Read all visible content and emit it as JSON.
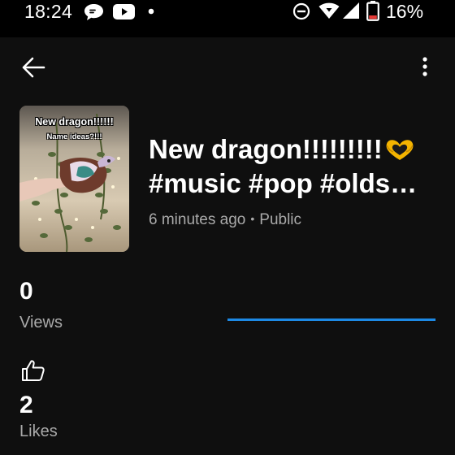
{
  "status_bar": {
    "time": "18:24",
    "battery_percent": "16%",
    "icons": [
      "chat-bubble-icon",
      "youtube-icon",
      "dot-icon",
      "do-not-disturb-icon",
      "wifi-icon",
      "signal-icon",
      "battery-icon"
    ]
  },
  "top_bar": {
    "back_icon": "arrow-left-icon",
    "more_icon": "more-vertical-icon"
  },
  "video": {
    "thumbnail_caption_1": "New dragon!!!!!!",
    "thumbnail_caption_2": "Name ideas?!!!",
    "title_line_1": "New dragon!!!!!!!!!",
    "title_line_2": "#music #pop #olds…",
    "posted": "6 minutes ago",
    "separator": "•",
    "visibility": "Public"
  },
  "stats": {
    "views_count": "0",
    "views_label": "Views",
    "likes_count": "2",
    "likes_label": "Likes",
    "likes_icon": "thumbs-up-icon"
  },
  "views_progress": {
    "fraction": 1.0,
    "color": "#1d89e4"
  },
  "colors": {
    "background": "#0f0f0f",
    "status_background": "#000000",
    "secondary_text": "#aaaaaa",
    "accent_blue": "#1d89e4",
    "battery_red": "#e53935"
  }
}
